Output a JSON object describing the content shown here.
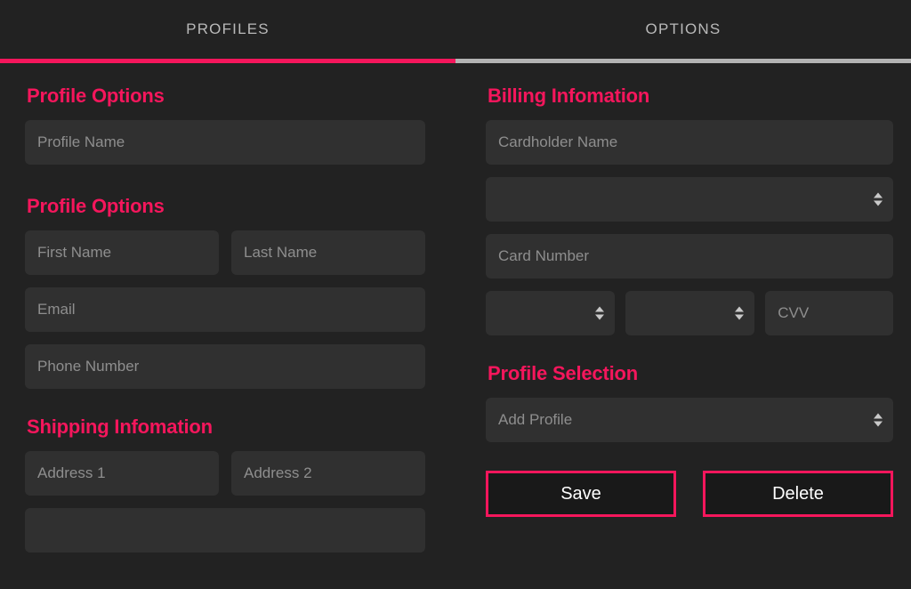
{
  "colors": {
    "accent": "#f5165c",
    "background": "#222222",
    "field_background": "#303030",
    "placeholder": "#8e8e8e",
    "tab_label": "#b9b9b9",
    "tab_inactive_underline": "#b3b3b3",
    "button_text": "#ffffff",
    "button_background": "#191919"
  },
  "tabs": [
    {
      "label": "PROFILES",
      "active": true
    },
    {
      "label": "OPTIONS",
      "active": false
    }
  ],
  "left_column": {
    "sections": [
      {
        "title": "Profile Options",
        "fields": [
          {
            "name": "profile-name",
            "placeholder": "Profile Name",
            "value": "",
            "type": "text"
          }
        ]
      },
      {
        "title": "Profile Options",
        "fields": [
          {
            "name": "first-name",
            "placeholder": "First Name",
            "value": "",
            "type": "text"
          },
          {
            "name": "last-name",
            "placeholder": "Last Name",
            "value": "",
            "type": "text"
          },
          {
            "name": "email",
            "placeholder": "Email",
            "value": "",
            "type": "text"
          },
          {
            "name": "phone-number",
            "placeholder": "Phone Number",
            "value": "",
            "type": "text"
          }
        ]
      },
      {
        "title": "Shipping Infomation",
        "fields": [
          {
            "name": "address-1",
            "placeholder": "Address 1",
            "value": "",
            "type": "text"
          },
          {
            "name": "address-2",
            "placeholder": "Address 2",
            "value": "",
            "type": "text"
          },
          {
            "name": "shipping-extra",
            "placeholder": "",
            "value": "",
            "type": "text"
          }
        ]
      }
    ]
  },
  "right_column": {
    "billing": {
      "title": "Billing Infomation",
      "cardholder_name": {
        "placeholder": "Cardholder Name",
        "value": ""
      },
      "card_type": {
        "placeholder": "",
        "value": ""
      },
      "card_number": {
        "placeholder": "Card Number",
        "value": ""
      },
      "exp_month": {
        "placeholder": "",
        "value": ""
      },
      "exp_year": {
        "placeholder": "",
        "value": ""
      },
      "cvv": {
        "placeholder": "CVV",
        "value": ""
      }
    },
    "profile_selection": {
      "title": "Profile Selection",
      "dropdown": {
        "value": "Add Profile"
      }
    },
    "buttons": {
      "save_label": "Save",
      "delete_label": "Delete"
    }
  }
}
